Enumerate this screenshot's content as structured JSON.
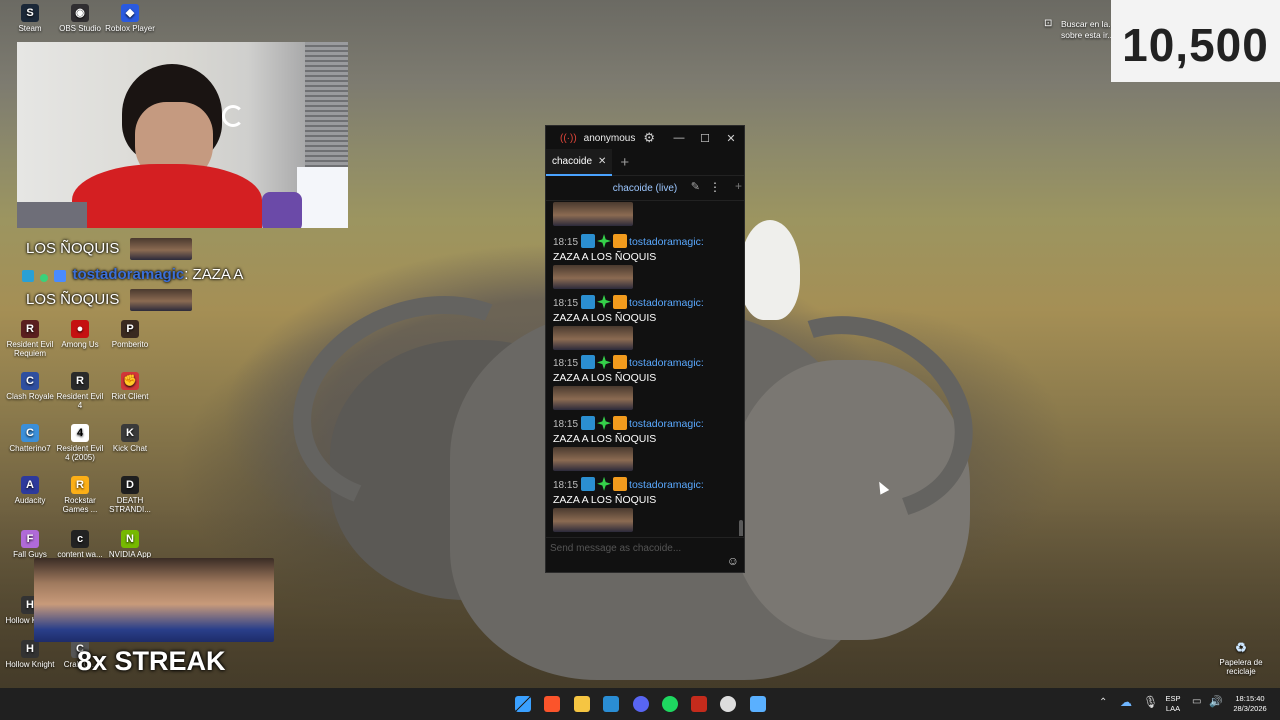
{
  "desktop": {
    "icons": [
      {
        "label": "Steam",
        "glyph": "S",
        "color": "#1b2838",
        "col": 0,
        "row": 0
      },
      {
        "label": "OBS Studio",
        "glyph": "◉",
        "color": "#302e31",
        "col": 1,
        "row": 0
      },
      {
        "label": "Roblox Player",
        "glyph": "◆",
        "color": "#2a5adf",
        "col": 2,
        "row": 0
      },
      {
        "label": "Resident Evil Requiem",
        "glyph": "R",
        "color": "#5a1f1f",
        "col": 0,
        "row": 6
      },
      {
        "label": "Among Us",
        "glyph": "●",
        "color": "#c51111",
        "col": 1,
        "row": 6
      },
      {
        "label": "Pomberito",
        "glyph": "P",
        "color": "#3a2a20",
        "col": 2,
        "row": 6
      },
      {
        "label": "Clash Royale",
        "glyph": "C",
        "color": "#2f4fa0",
        "col": 0,
        "row": 7
      },
      {
        "label": "Resident Evil 4",
        "glyph": "R",
        "color": "#2a2a2a",
        "col": 1,
        "row": 7
      },
      {
        "label": "Riot Client",
        "glyph": "✊",
        "color": "#d13639",
        "col": 2,
        "row": 7
      },
      {
        "label": "Chatterino7",
        "glyph": "C",
        "color": "#3b8fd9",
        "col": 0,
        "row": 8
      },
      {
        "label": "Resident Evil 4 (2005)",
        "glyph": "4",
        "color": "#ffffff",
        "col": 1,
        "row": 8
      },
      {
        "label": "Kick Chat",
        "glyph": "K",
        "color": "#3a3a3a",
        "col": 2,
        "row": 8
      },
      {
        "label": "Audacity",
        "glyph": "A",
        "color": "#2d3a9c",
        "col": 0,
        "row": 9
      },
      {
        "label": "Rockstar Games ...",
        "glyph": "R",
        "color": "#fcaf17",
        "col": 1,
        "row": 9
      },
      {
        "label": "DEATH STRANDI...",
        "glyph": "D",
        "color": "#1f1f1f",
        "col": 2,
        "row": 9
      },
      {
        "label": "Fall Guys",
        "glyph": "F",
        "color": "#b06ad8",
        "col": 0,
        "row": 10
      },
      {
        "label": "content wa...",
        "glyph": "c",
        "color": "#222222",
        "col": 1,
        "row": 10
      },
      {
        "label": "NVIDIA App",
        "glyph": "N",
        "color": "#76b900",
        "col": 2,
        "row": 10
      },
      {
        "label": "Hollow Knight",
        "glyph": "H",
        "color": "#333333",
        "col": 0,
        "row": 11
      },
      {
        "label": "Hollow Knight",
        "glyph": "H",
        "color": "#333333",
        "col": 0,
        "row": 12
      },
      {
        "label": "Crab G...",
        "glyph": "C",
        "color": "#555555",
        "col": 1,
        "row": 12
      }
    ],
    "recycle_bin": {
      "label": "Papelera de reciclaje"
    },
    "search_hint": "Buscar en la... sobre esta ir...",
    "counter": "10,500"
  },
  "stream_overlay": {
    "chat_line_1": "LOS ÑOQUIS",
    "chat_line_2_user": "tostadoramagic",
    "chat_line_2_text": ": ZAZA A",
    "chat_line_3": "LOS ÑOQUIS",
    "streak": "8x STREAK"
  },
  "chat_window": {
    "account": "anonymous",
    "tab_label": "chacoide",
    "channel_header": "chacoide (live)",
    "input_placeholder": "Send message as chacoide...",
    "messages": [
      {
        "time": "18:15",
        "user": "tostadoramagic:",
        "text": "ZAZA A LOS ÑOQUIS"
      },
      {
        "time": "18:15",
        "user": "tostadoramagic:",
        "text": "ZAZA A LOS ÑOQUIS"
      },
      {
        "time": "18:15",
        "user": "tostadoramagic:",
        "text": "ZAZA A LOS ÑOQUIS"
      },
      {
        "time": "18:15",
        "user": "tostadoramagic:",
        "text": "ZAZA A LOS ÑOQUIS"
      },
      {
        "time": "18:15",
        "user": "tostadoramagic:",
        "text": "ZAZA A LOS ÑOQUIS"
      }
    ]
  },
  "taskbar": {
    "lang_line1": "ESP",
    "lang_line2": "LAA",
    "time": "18:15:40",
    "date": "28/3/2026",
    "apps": [
      "windows-start-icon",
      "brave-icon",
      "file-explorer-icon",
      "bing-icon",
      "discord-icon",
      "spotify-icon",
      "news-app-icon",
      "obs-icon",
      "chatterino-icon"
    ]
  }
}
